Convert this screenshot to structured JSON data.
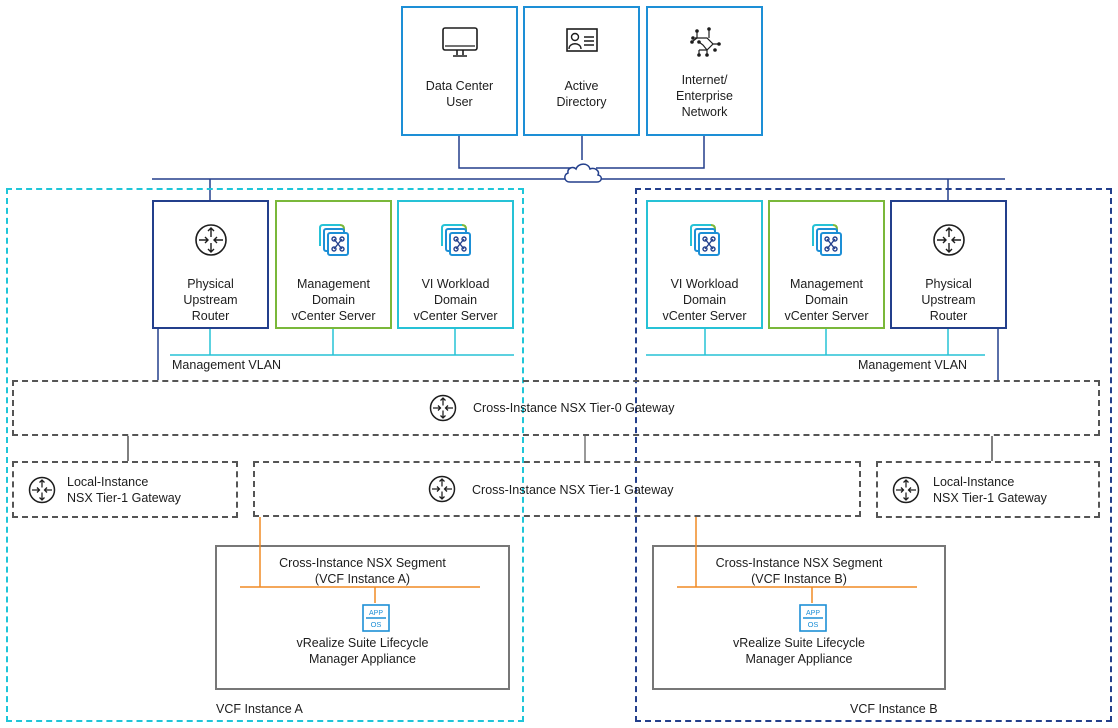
{
  "external": [
    {
      "label_lines": [
        "Data Center",
        "User"
      ],
      "icon": "monitor-icon"
    },
    {
      "label_lines": [
        "Active",
        "Directory"
      ],
      "icon": "id-card-icon"
    },
    {
      "label_lines": [
        "Internet/",
        "Enterprise",
        "Network"
      ],
      "icon": "network-graph-icon"
    }
  ],
  "cloud_icon": "cloud-icon",
  "instance_a": {
    "label": "VCF Instance A",
    "nodes": [
      {
        "label_lines": [
          "Physical",
          "Upstream",
          "Router"
        ],
        "icon": "router-icon"
      },
      {
        "label_lines": [
          "Management",
          "Domain",
          "vCenter Server"
        ],
        "icon": "vcenter-icon"
      },
      {
        "label_lines": [
          "VI Workload",
          "Domain",
          "vCenter Server"
        ],
        "icon": "vcenter-icon"
      }
    ],
    "vlan_label": "Management VLAN",
    "local_gateway_lines": [
      "Local-Instance",
      "NSX Tier-1 Gateway"
    ],
    "segment_lines": [
      "Cross-Instance NSX Segment",
      "(VCF Instance A)"
    ],
    "appliance_lines": [
      "vRealize Suite Lifecycle",
      "Manager Appliance"
    ],
    "app_icon": {
      "top": "APP",
      "bottom": "OS"
    }
  },
  "instance_b": {
    "label": "VCF Instance B",
    "nodes": [
      {
        "label_lines": [
          "VI Workload",
          "Domain",
          "vCenter Server"
        ],
        "icon": "vcenter-icon"
      },
      {
        "label_lines": [
          "Management",
          "Domain",
          "vCenter Server"
        ],
        "icon": "vcenter-icon"
      },
      {
        "label_lines": [
          "Physical",
          "Upstream",
          "Router"
        ],
        "icon": "router-icon"
      }
    ],
    "vlan_label": "Management VLAN",
    "local_gateway_lines": [
      "Local-Instance",
      "NSX Tier-1 Gateway"
    ],
    "segment_lines": [
      "Cross-Instance NSX Segment",
      "(VCF Instance B)"
    ],
    "appliance_lines": [
      "vRealize Suite Lifecycle",
      "Manager Appliance"
    ],
    "app_icon": {
      "top": "APP",
      "bottom": "OS"
    }
  },
  "tier0_label": "Cross-Instance NSX Tier-0 Gateway",
  "tier1_label": "Cross-Instance NSX Tier-1 Gateway",
  "colors": {
    "external_border": "#1d8fd6",
    "router_border": "#233f8c",
    "mgmt_border": "#7ab83a",
    "vi_border": "#26c2d6",
    "instance_a_dash": "#1fc6d9",
    "instance_b_dash": "#233f8c",
    "segment_line": "#f08a24",
    "gateway_dash": "#555555"
  }
}
